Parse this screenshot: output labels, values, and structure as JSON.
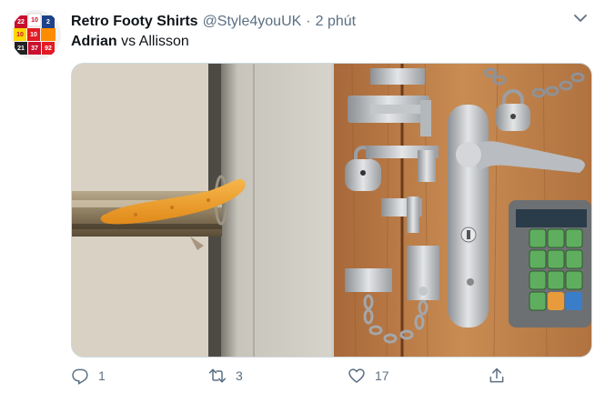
{
  "tweet": {
    "display_name": "Retro Footy Shirts",
    "handle": "@Style4youUK",
    "separator": "·",
    "time": "2 phút",
    "text_bold": "Adrian",
    "text_rest": " vs Allisson"
  },
  "actions": {
    "reply_count": "1",
    "retweet_count": "3",
    "like_count": "17"
  },
  "colors": {
    "secondary_text": "#5b7083",
    "primary_text": "#0f1419",
    "border": "#cfd9de"
  },
  "icons": [
    "avatar-shirts",
    "chevron-down-icon",
    "reply-icon",
    "retweet-icon",
    "like-icon",
    "share-icon"
  ],
  "avatar": {
    "numbers": [
      "22",
      "10",
      "2",
      "10",
      "10",
      "21",
      "37",
      "92"
    ]
  }
}
